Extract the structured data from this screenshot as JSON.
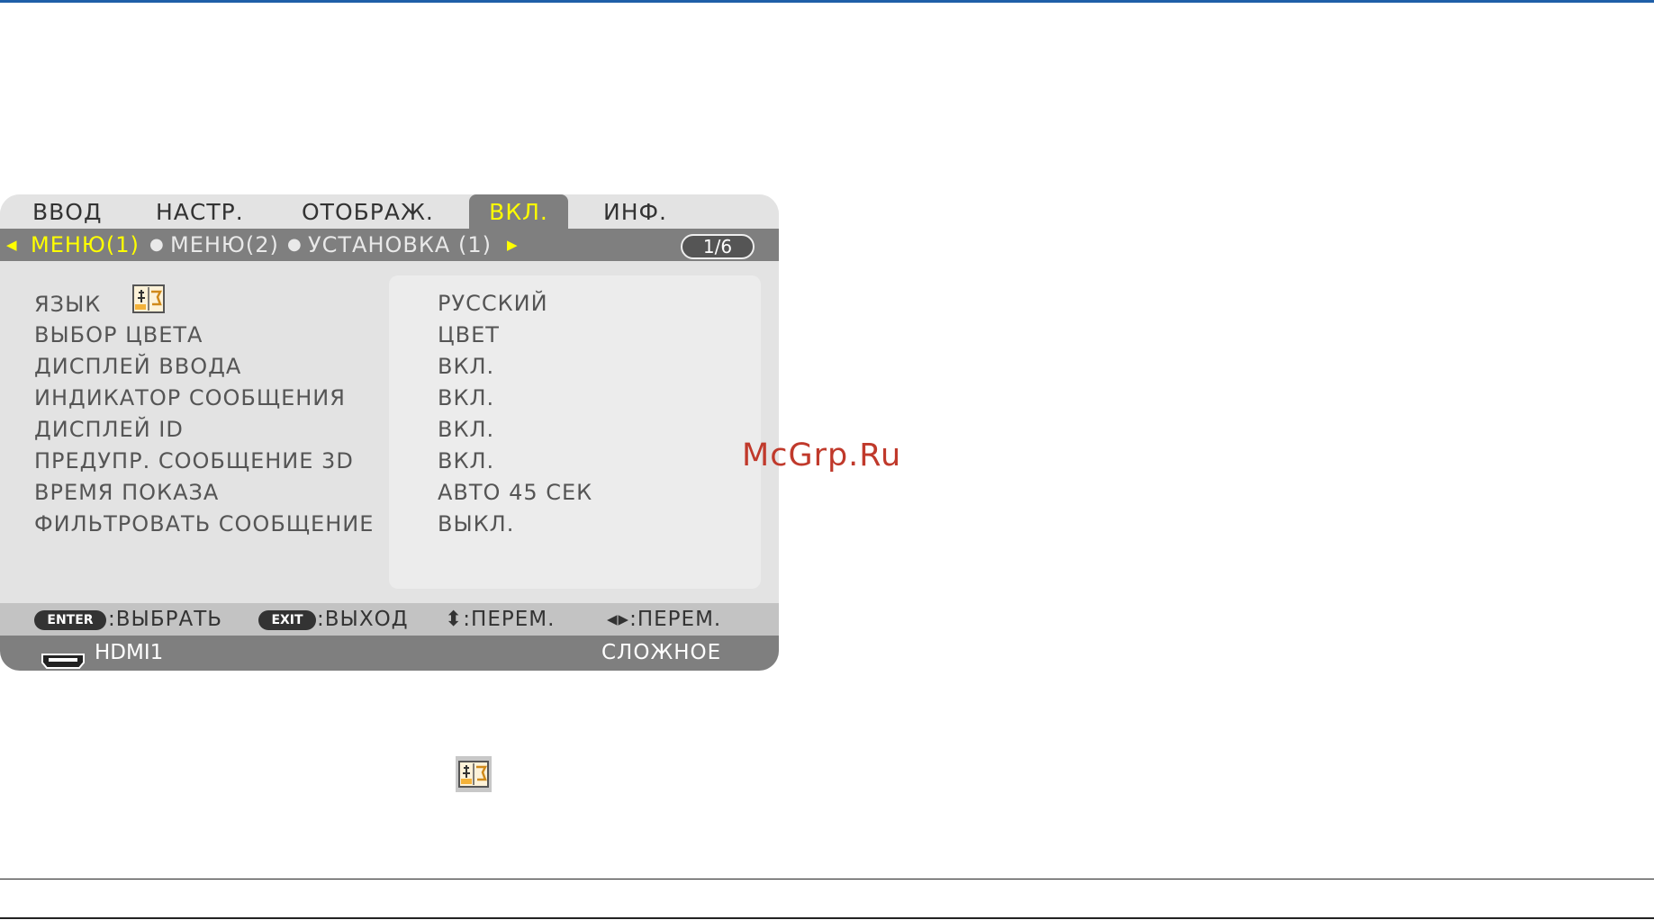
{
  "tabs": [
    {
      "label": "ВВОД",
      "active": false
    },
    {
      "label": "НАСТР.",
      "active": false
    },
    {
      "label": "ОТОБРАЖ.",
      "active": false
    },
    {
      "label": "ВКЛ.",
      "active": true
    },
    {
      "label": "ИНФ.",
      "active": false
    }
  ],
  "submenu": {
    "items": [
      "МЕНЮ(1)",
      "МЕНЮ(2)",
      "УСТАНОВКА (1)"
    ],
    "current": "МЕНЮ(1)",
    "page": "1/6"
  },
  "settings": [
    {
      "label": "ЯЗЫК",
      "value": "РУССКИЙ"
    },
    {
      "label": "ВЫБОР ЦВЕТА",
      "value": "ЦВЕТ"
    },
    {
      "label": "ДИСПЛЕЙ ВВОДА",
      "value": "ВКЛ."
    },
    {
      "label": "ИНДИКАТОР СООБЩЕНИЯ",
      "value": "ВКЛ."
    },
    {
      "label": "ДИСПЛЕЙ ID",
      "value": "ВКЛ."
    },
    {
      "label": "ПРЕДУПР. СООБЩЕНИЕ 3D",
      "value": "ВКЛ."
    },
    {
      "label": "ВРЕМЯ ПОКАЗА",
      "value": "АВТО 45 СЕК"
    },
    {
      "label": "ФИЛЬТРОВАТЬ СООБЩЕНИЕ",
      "value": "ВЫКЛ."
    }
  ],
  "help": {
    "enter_key": "ENTER",
    "enter_text": ":ВЫБРАТЬ",
    "exit_key": "EXIT",
    "exit_text": ":ВЫХОД",
    "updown_text": "⬍:ПЕРЕМ.",
    "leftright_text": "◂▸:ПЕРЕМ."
  },
  "status": {
    "source": "HDMI1",
    "mode": "СЛОЖНОЕ"
  },
  "watermark": "McGrp.Ru",
  "icons": {
    "language": "language-icon",
    "hdmi": "hdmi-connector-icon"
  },
  "colors": {
    "highlight": "#ffff00",
    "bar": "#7f7f7f",
    "panel": "#e3e3e3",
    "watermark": "#c0392b"
  }
}
